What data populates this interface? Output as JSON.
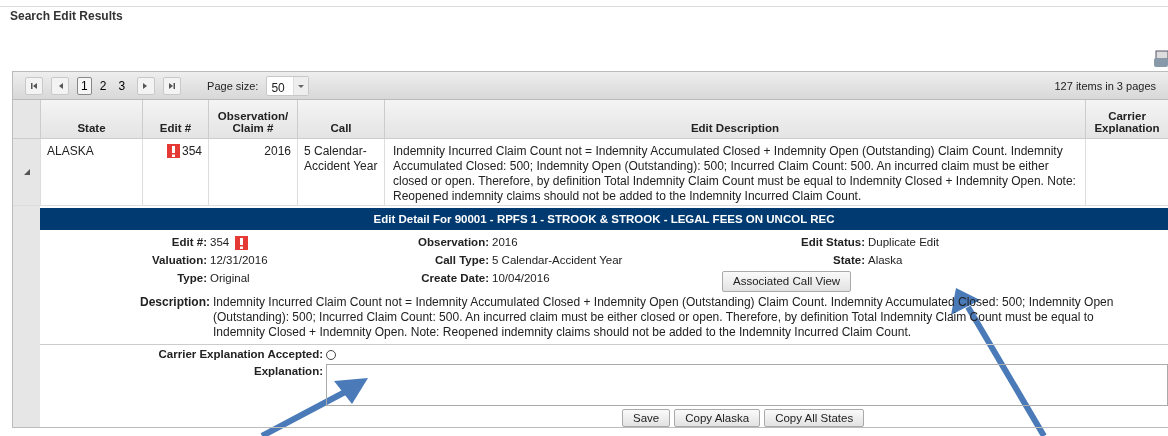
{
  "title": "Search Edit Results",
  "pager": {
    "pages": [
      {
        "label": "1",
        "selected": true
      },
      {
        "label": "2",
        "selected": false
      },
      {
        "label": "3",
        "selected": false
      }
    ],
    "page_size_label": "Page size:",
    "page_size": "50",
    "summary": "127 items in 3 pages"
  },
  "table": {
    "columns": [
      "State",
      "Edit #",
      "Observation/ Claim #",
      "Call",
      "Edit Description",
      "Carrier Explanation"
    ],
    "rows": [
      {
        "expanded": true,
        "state": "ALASKA",
        "edit": "354",
        "flagged": true,
        "observation": "2016",
        "call": "5 Calendar-Accident Year",
        "description": "Indemnity Incurred Claim Count not = Indemnity Accumulated Closed + Indemnity Open (Outstanding) Claim Count. Indemnity Accumulated Closed: 500; Indemnity Open (Outstanding): 500; Incurred Claim Count: 500. An incurred claim must be either closed or open. Therefore, by definition Total Indemnity Claim Count must be equal to Indemnity Closed + Indemnity Open. Note: Reopened indemnity claims should not be added to the Indemnity Incurred Claim Count."
      }
    ]
  },
  "detail": {
    "title": "Edit Detail For 90001 - RPFS 1 - STROOK & STROOK - LEGAL FEES ON UNCOL REC",
    "fields": [
      {
        "label": "Edit #:",
        "value": "354",
        "flagged": true
      },
      {
        "label": "Observation:",
        "value": "2016",
        "flagged": false
      },
      {
        "label": "Edit Status:",
        "value": "Duplicate Edit",
        "flagged": false
      },
      {
        "label": "Valuation:",
        "value": "12/31/2016",
        "flagged": false
      },
      {
        "label": "Call Type:",
        "value": "5 Calendar-Accident Year",
        "flagged": false
      },
      {
        "label": "State:",
        "value": "Alaska",
        "flagged": false
      },
      {
        "label": "Type:",
        "value": "Original",
        "flagged": false
      },
      {
        "label": "Create Date:",
        "value": "10/04/2016",
        "flagged": false
      }
    ],
    "call_view_button": "Associated Call View",
    "description_label": "Description:",
    "description": "Indemnity Incurred Claim Count not = Indemnity Accumulated Closed + Indemnity Open (Outstanding) Claim Count. Indemnity Accumulated Closed: 500; Indemnity Open (Outstanding): 500; Incurred Claim Count: 500. An incurred claim must be either closed or open. Therefore, by definition Total Indemnity Claim Count must be equal to Indemnity Closed + Indemnity Open. Note: Reopened indemnity claims should not be added to the Indemnity Incurred Claim Count.",
    "accepted_label": "Carrier Explanation Accepted:",
    "accepted": false,
    "explanation_label": "Explanation:",
    "buttons": [
      "Save",
      "Copy Alaska",
      "Copy All States"
    ]
  }
}
